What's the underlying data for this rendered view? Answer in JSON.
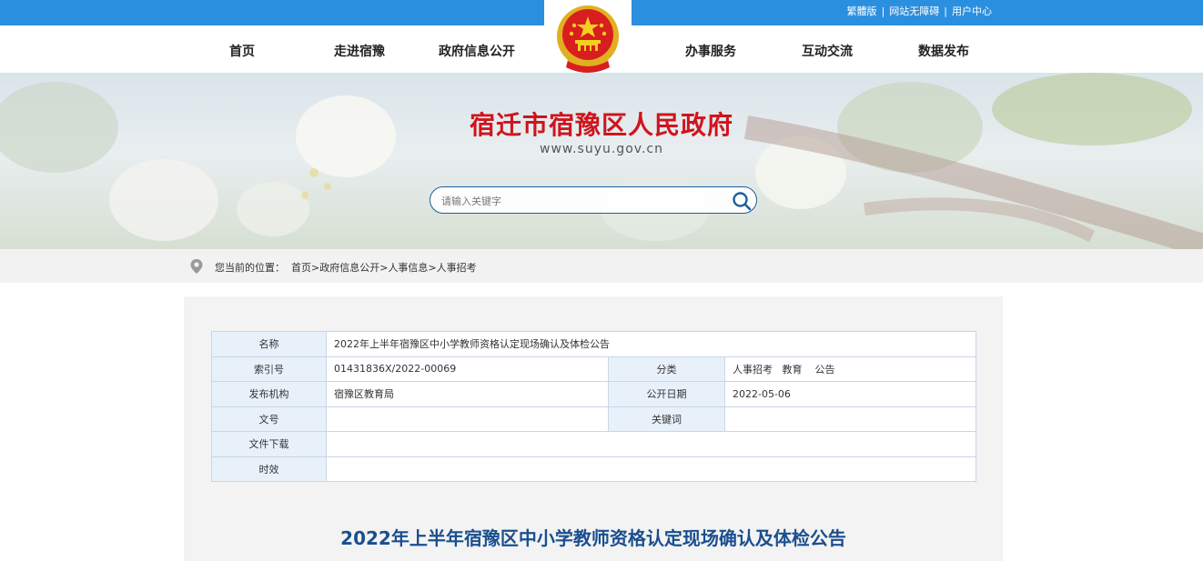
{
  "top_links": [
    "繁體版",
    "网站无障碍",
    "用户中心"
  ],
  "top_sep": "|",
  "nav": {
    "left": [
      "首页",
      "走进宿豫",
      "政府信息公开"
    ],
    "right": [
      "办事服务",
      "互动交流",
      "数据发布"
    ]
  },
  "site": {
    "title": "宿迁市宿豫区人民政府",
    "url": "www.suyu.gov.cn"
  },
  "search": {
    "placeholder": "请输入关键字"
  },
  "breadcrumb": {
    "prefix": "您当前的位置：",
    "items": [
      "首页",
      "政府信息公开",
      "人事信息",
      "人事招考"
    ],
    "sep": ">"
  },
  "meta": {
    "name_label": "名称",
    "name_value": "2022年上半年宿豫区中小学教师资格认定现场确认及体检公告",
    "index_label": "索引号",
    "index_value": "01431836X/2022-00069",
    "category_label": "分类",
    "category_value": "人事招考   教育    公告",
    "org_label": "发布机构",
    "org_value": "宿豫区教育局",
    "date_label": "公开日期",
    "date_value": "2022-05-06",
    "doc_label": "文号",
    "doc_value": "",
    "keyword_label": "关键词",
    "keyword_value": "",
    "download_label": "文件下载",
    "download_value": "",
    "validity_label": "时效",
    "validity_value": ""
  },
  "article": {
    "title": "2022年上半年宿豫区中小学教师资格认定现场确认及体检公告"
  },
  "colors": {
    "top_blue": "#2b8fe0",
    "title_red": "#d0141c",
    "article_blue": "#1a4f8f",
    "label_bg": "#e8f0fa"
  }
}
